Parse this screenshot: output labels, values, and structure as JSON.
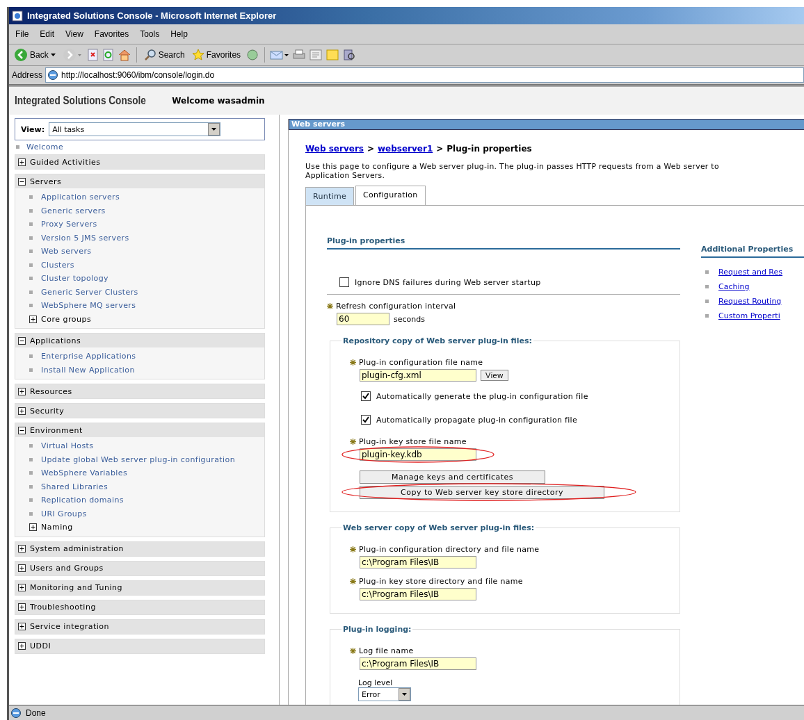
{
  "window": {
    "title": "Integrated Solutions Console - Microsoft Internet Explorer"
  },
  "menu": [
    "File",
    "Edit",
    "View",
    "Favorites",
    "Tools",
    "Help"
  ],
  "toolbar": {
    "back_label": "Back",
    "search_label": "Search",
    "favorites_label": "Favorites"
  },
  "address": {
    "label": "Address",
    "url": "http://localhost:9060/ibm/console/login.do"
  },
  "console": {
    "title": "Integrated Solutions Console",
    "welcome": "Welcome wasadmin"
  },
  "nav": {
    "view_label": "View:",
    "view_value": "All tasks",
    "welcome": "Welcome",
    "sections": [
      {
        "label": "Guided Activities",
        "expanded": false
      },
      {
        "label": "Servers",
        "expanded": true,
        "items": [
          {
            "kind": "link",
            "label": "Application servers"
          },
          {
            "kind": "link",
            "label": "Generic servers"
          },
          {
            "kind": "link",
            "label": "Proxy Servers"
          },
          {
            "kind": "link",
            "label": "Version 5 JMS servers"
          },
          {
            "kind": "link",
            "label": "Web servers"
          },
          {
            "kind": "link",
            "label": "Clusters"
          },
          {
            "kind": "link",
            "label": "Cluster topology"
          },
          {
            "kind": "link",
            "label": "Generic Server Clusters"
          },
          {
            "kind": "link",
            "label": "WebSphere MQ servers"
          },
          {
            "kind": "group",
            "label": "Core groups",
            "expanded": false
          }
        ]
      },
      {
        "label": "Applications",
        "expanded": true,
        "items": [
          {
            "kind": "link",
            "label": "Enterprise Applications"
          },
          {
            "kind": "link",
            "label": "Install New Application"
          }
        ]
      },
      {
        "label": "Resources",
        "expanded": false
      },
      {
        "label": "Security",
        "expanded": false
      },
      {
        "label": "Environment",
        "expanded": true,
        "items": [
          {
            "kind": "link",
            "label": "Virtual Hosts"
          },
          {
            "kind": "link",
            "label": "Update global Web server plug-in configuration"
          },
          {
            "kind": "link",
            "label": "WebSphere Variables"
          },
          {
            "kind": "link",
            "label": "Shared Libraries"
          },
          {
            "kind": "link",
            "label": "Replication domains"
          },
          {
            "kind": "link",
            "label": "URI Groups"
          },
          {
            "kind": "group",
            "label": "Naming",
            "expanded": false
          }
        ]
      },
      {
        "label": "System administration",
        "expanded": false
      },
      {
        "label": "Users and Groups",
        "expanded": false
      },
      {
        "label": "Monitoring and Tuning",
        "expanded": false
      },
      {
        "label": "Troubleshooting",
        "expanded": false
      },
      {
        "label": "Service integration",
        "expanded": false
      },
      {
        "label": "UDDI",
        "expanded": false
      }
    ]
  },
  "content": {
    "header": "Web servers",
    "breadcrumb": [
      {
        "label": "Web servers",
        "link": true
      },
      {
        "label": "webserver1",
        "link": true
      },
      {
        "label": "Plug-in properties",
        "link": false
      }
    ],
    "separator": ">",
    "description_lines": [
      "Use this page to configure a Web server plug-in. The plug-in passes HTTP requests from a Web server to",
      "Application Servers."
    ],
    "tabs": [
      {
        "label": "Runtime",
        "selected": false
      },
      {
        "label": "Configuration",
        "selected": true
      }
    ],
    "plugin_properties": {
      "heading": "Plug-in properties",
      "items": [
        {
          "kind": "checkbox",
          "label": "Ignore DNS failures during Web server startup",
          "checked": false
        },
        {
          "kind": "field",
          "label": "Refresh configuration interval",
          "required": true,
          "value": "60",
          "unit": "seconds",
          "circled": false
        }
      ]
    },
    "fieldsets": [
      {
        "legend": "Repository copy of Web server plug-in files:",
        "items": [
          {
            "kind": "field",
            "label": "Plug-in configuration file name",
            "required": true,
            "value": "plugin-cfg.xml",
            "button": "View",
            "circled": false
          },
          {
            "kind": "checkbox",
            "label": "Automatically generate the plug-in configuration file",
            "checked": true
          },
          {
            "kind": "checkbox",
            "label": "Automatically propagate plug-in configuration file",
            "checked": true
          },
          {
            "kind": "field",
            "label": "Plug-in key store file name",
            "required": true,
            "value": "plugin-key.kdb",
            "circled": true
          },
          {
            "kind": "button",
            "label": "Manage keys and certificates",
            "circled": false
          },
          {
            "kind": "button",
            "label": "Copy to Web server key store directory",
            "circled": true
          }
        ]
      },
      {
        "legend": "Web server copy of Web server plug-in files:",
        "items": [
          {
            "kind": "field",
            "label": "Plug-in configuration directory and file name",
            "required": true,
            "value": "c:\\Program Files\\IB",
            "circled": false
          },
          {
            "kind": "field",
            "label": "Plug-in key store directory and file name",
            "required": true,
            "value": "c:\\Program Files\\IB",
            "circled": false
          }
        ]
      },
      {
        "legend": "Plug-in logging:",
        "items": [
          {
            "kind": "field",
            "label": "Log file name",
            "required": true,
            "value": "c:\\Program Files\\IB",
            "circled": false
          },
          {
            "kind": "select",
            "label": "Log level",
            "value": "Error"
          }
        ]
      }
    ],
    "additional": {
      "heading": "Additional Properties",
      "links": [
        "Request and Res",
        "Caching",
        "Request Routing",
        "Custom Properti"
      ]
    }
  },
  "status_bar": {
    "text": "Done"
  }
}
